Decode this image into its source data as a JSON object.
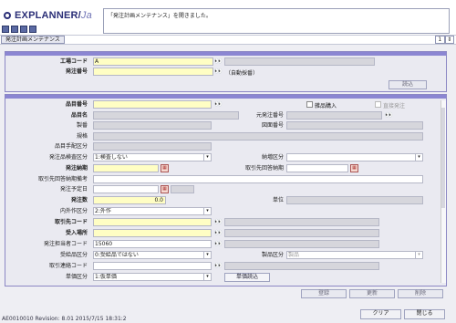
{
  "app": {
    "title": "EXPLANNER/",
    "title_suffix": "Ja",
    "message": "「発注計画メンテナンス」を開きました。"
  },
  "screen": {
    "tab_label": "発注計画メンテナンス",
    "zoom_value": "1"
  },
  "panel1": {
    "factory_code_label": "工場コード",
    "factory_code_value": "A",
    "order_no_label": "発注番号",
    "order_no_value": "",
    "auto_numbering": "（自動採番）",
    "read_button": "読込"
  },
  "panel2": {
    "item_no_label": "品目番号",
    "item_name_label": "品目名",
    "manufacturer_label": "製番",
    "spec_label": "規格",
    "arrangement_label": "品目手配区分",
    "inspect_label": "発注品検査区分",
    "inspect_value": "1:検査しない",
    "delivery_label": "発注納期",
    "supplier_reply_label": "取引先回答納期",
    "remarks_label": "取引先回答納期備考",
    "order_date_label": "発注予定日",
    "qty_label": "発注数",
    "qty_value": "0.0",
    "inout_label": "内外作区分",
    "inout_value": "2:外作",
    "supplier_label": "取引先コード",
    "receive_label": "受入場所",
    "staff_label": "発注担当者コード",
    "staff_value": "15060",
    "paid_label": "受給品区分",
    "paid_value": "0:受給品ではない",
    "contact_label": "取引連絡コード",
    "price_label": "単価区分",
    "price_value": "1:仮単価",
    "price_read_button": "単価読込",
    "misc_chk_label": "雑品購入",
    "direct_chk_label": "直接発注",
    "orig_order_label": "元発注番号",
    "drawing_label": "図面番号",
    "delivery_div_label": "納増区分",
    "unit_label": "単位",
    "product_div_label": "製品区分",
    "product_div_value": "製品"
  },
  "actions": {
    "register": "登録",
    "update": "更新",
    "delete": "削除",
    "clear": "クリア",
    "close": "閉じる"
  },
  "status": {
    "text": "AE0010010 Revision: 8.01 2015/7/15 18:31:2"
  }
}
